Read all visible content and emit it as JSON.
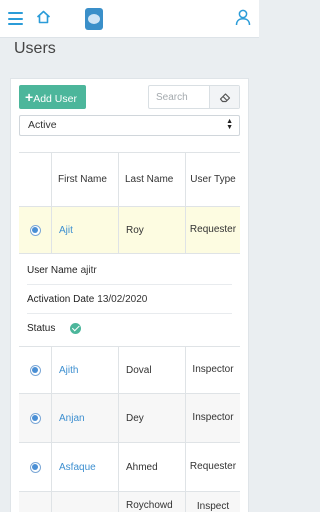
{
  "colors": {
    "accent": "#2b9cd8",
    "add_button": "#4cb69b",
    "link": "#3d8fd0",
    "selected_row": "#fdfce1"
  },
  "header": {
    "menu_icon": "hamburger-icon",
    "home_icon": "home-icon",
    "logo_icon": "app-logo",
    "user_icon": "user-icon"
  },
  "page": {
    "title": "Users"
  },
  "toolbar": {
    "add_user_label": "Add User",
    "search_placeholder": "Search",
    "clear_icon": "eraser-icon"
  },
  "filter": {
    "selected": "Active"
  },
  "table": {
    "headers": [
      "First Name",
      "Last Name",
      "User Type"
    ],
    "rows": [
      {
        "first": "Ajit",
        "last": "Roy",
        "type": "Requester"
      },
      {
        "first": "Ajith",
        "last": "Doval",
        "type": "Inspector"
      },
      {
        "first": "Anjan",
        "last": "Dey",
        "type": "Inspector"
      },
      {
        "first": "Asfaque",
        "last": "Ahmed",
        "type": "Requester"
      },
      {
        "first": "",
        "last": "Roychowd",
        "type": "Inspect"
      }
    ]
  },
  "details": {
    "username_label": "User Name",
    "username_value": "ajitr",
    "activation_label": "Activation Date",
    "activation_value": "13/02/2020",
    "status_label": "Status"
  }
}
